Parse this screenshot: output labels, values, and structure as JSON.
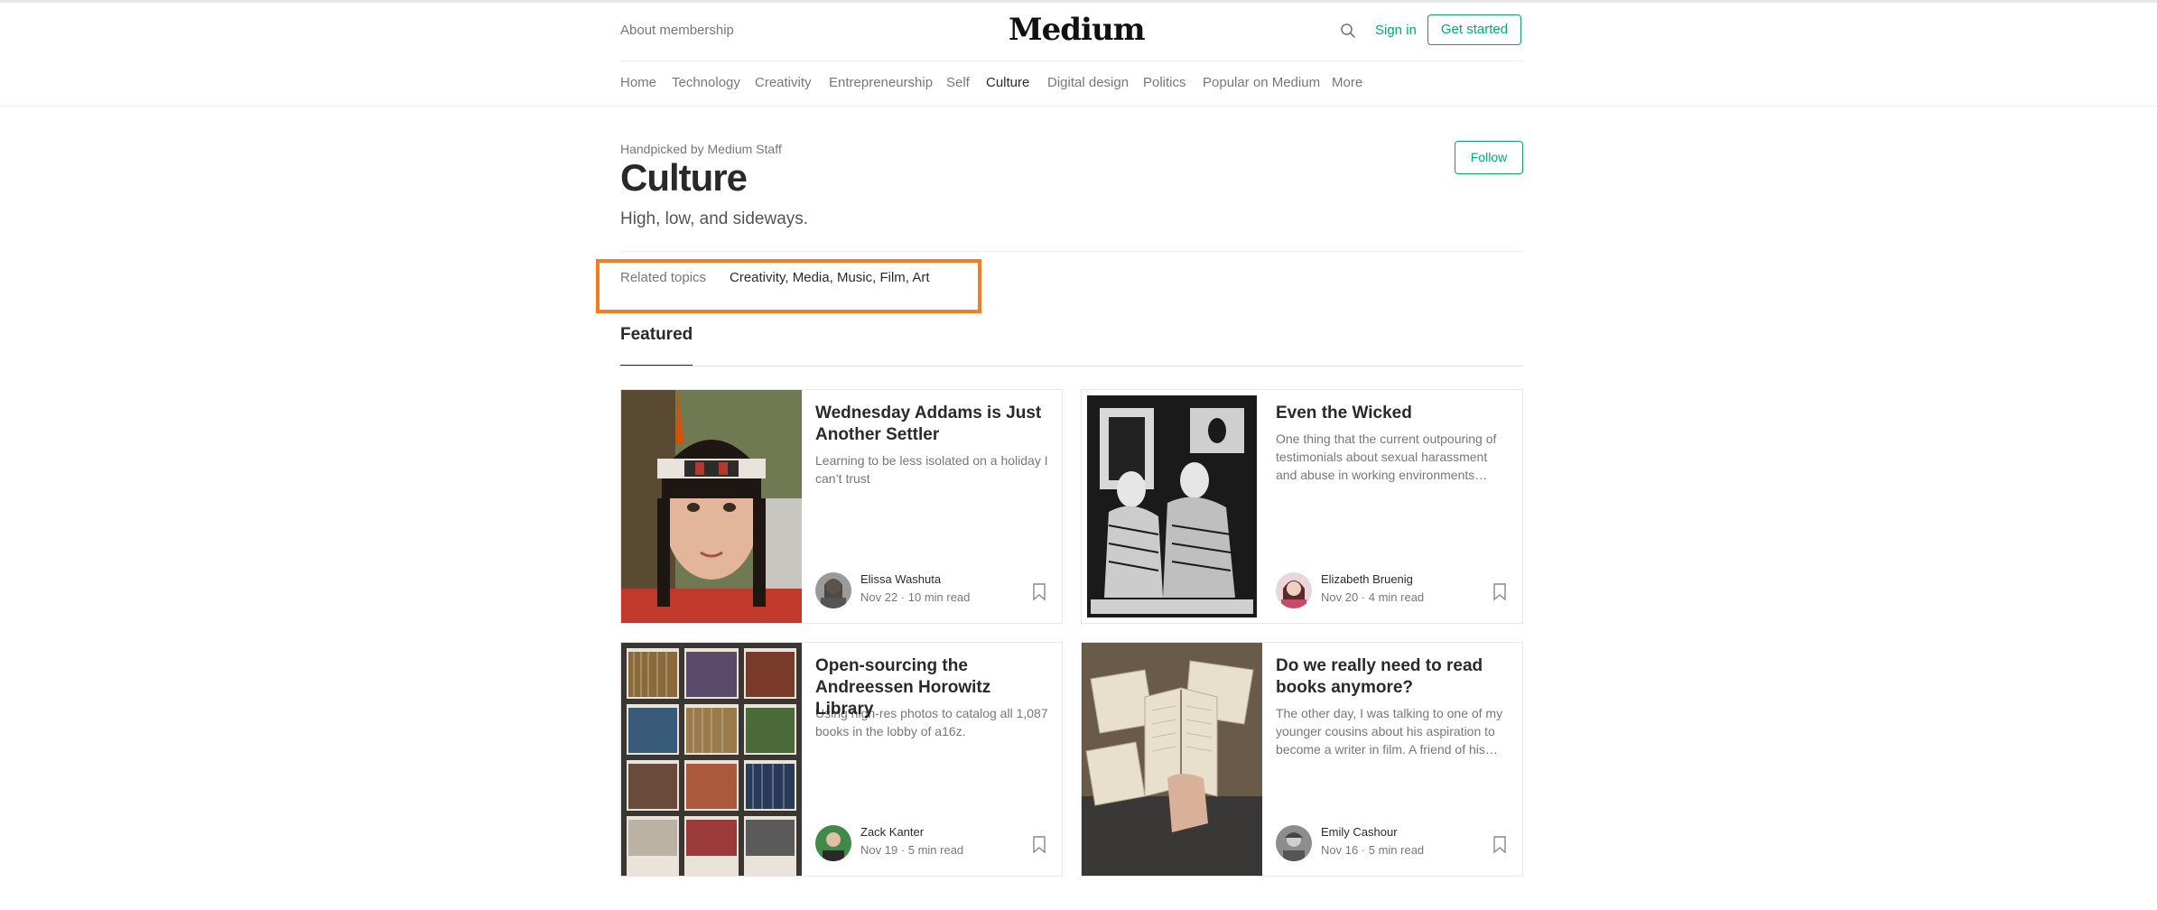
{
  "header": {
    "membership_link": "About membership",
    "logo": "Medium",
    "search_icon": "search-icon",
    "sign_in": "Sign in",
    "get_started": "Get started"
  },
  "nav": {
    "items": [
      "Home",
      "Technology",
      "Creativity",
      "Entrepreneurship",
      "Self",
      "Culture",
      "Digital design",
      "Politics",
      "Popular on Medium",
      "More"
    ],
    "active": "Culture"
  },
  "topic": {
    "handpicked": "Handpicked by Medium Staff",
    "title": "Culture",
    "follow": "Follow",
    "description": "High, low, and sideways."
  },
  "related": {
    "label": "Related topics",
    "topics": [
      "Creativity",
      "Media",
      "Music",
      "Film",
      "Art"
    ],
    "separators": [
      ",",
      ",",
      ",",
      ","
    ]
  },
  "featured_label": "Featured",
  "cards": [
    {
      "title": "Wednesday Addams is Just Another Settler",
      "description": "Learning to be less isolated on a holiday I can’t trust",
      "author": "Elissa Washuta",
      "meta": "Nov 22 · 10 min read",
      "image": "girl-headband-portrait"
    },
    {
      "title": "Even the Wicked",
      "description": "One thing that the current outpouring of testimonials about sexual harassment and abuse in working environments…",
      "author": "Elizabeth Bruenig",
      "meta": "Nov 20 · 4 min read",
      "image": "woodcut-illustration"
    },
    {
      "title": "Open-sourcing the Andreessen Horowitz Library",
      "description": "Using high-res photos to catalog all 1,087 books in the lobby of a16z.",
      "author": "Zack Kanter",
      "meta": "Nov 19 · 5 min read",
      "image": "bookshelves"
    },
    {
      "title": "Do we really need to read books anymore?",
      "description": "The other day, I was talking to one of my younger cousins about his aspiration to become a writer in film. A friend of his…",
      "author": "Emily Cashour",
      "meta": "Nov 16 · 5 min read",
      "image": "open-books"
    }
  ],
  "colors": {
    "accent": "#03a87c",
    "highlight_box": "#f07f23"
  }
}
